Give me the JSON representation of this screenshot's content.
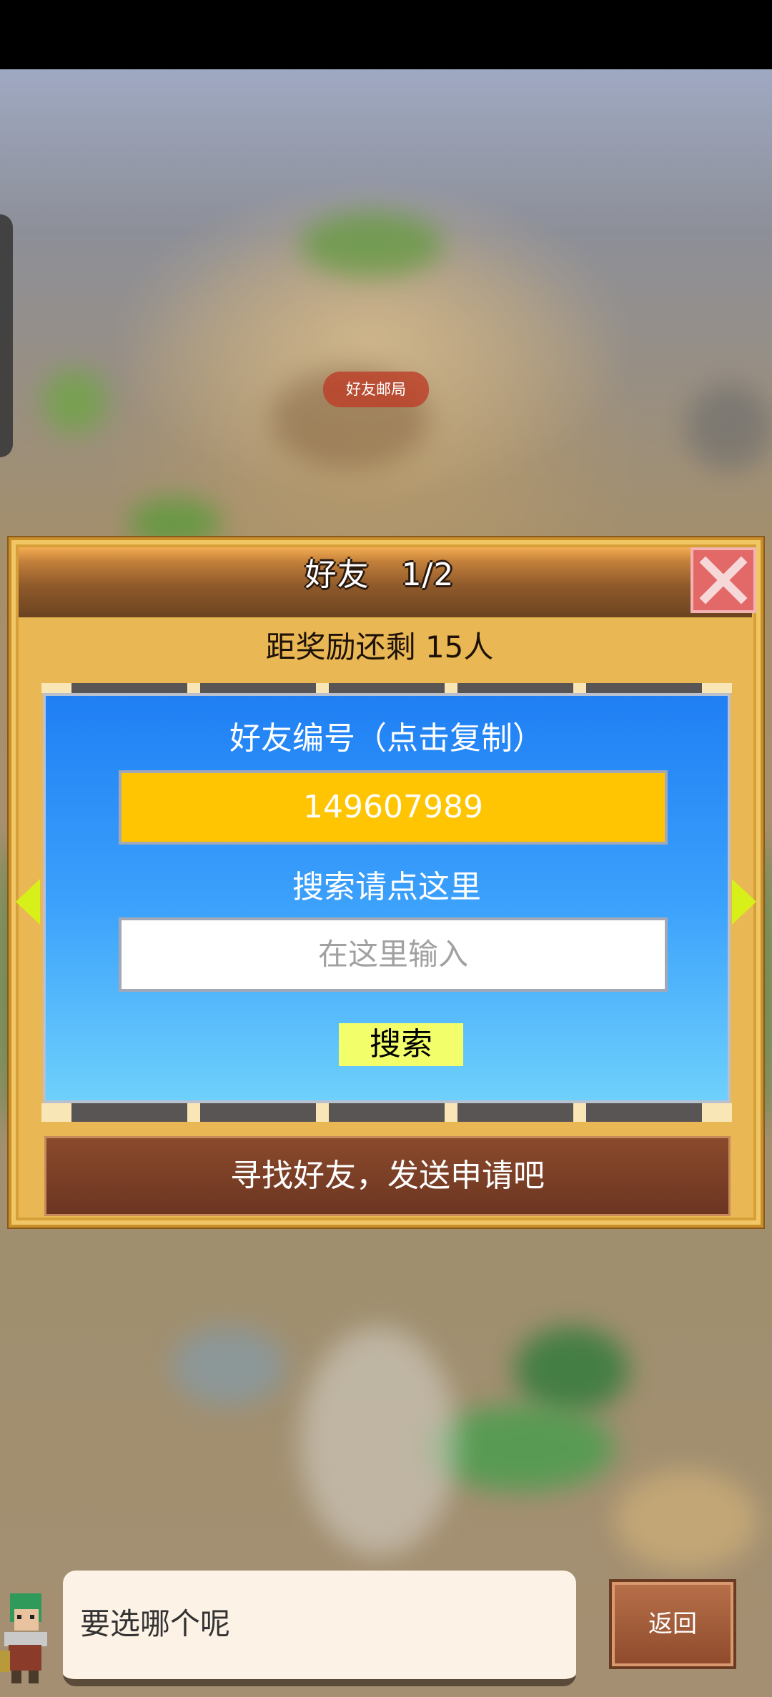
{
  "map": {
    "building_label": "好友邮局"
  },
  "dialog": {
    "title": "好友   1/2",
    "reward_text": "距奖励还剩 15人",
    "friend_code_label": "好友编号（点击复制）",
    "friend_code": "149607989",
    "search_hint": "搜索请点这里",
    "search_placeholder": "在这里输入",
    "search_button": "搜索",
    "find_friends_button": "寻找好友，发送申请吧"
  },
  "footer": {
    "speech_text": "要选哪个呢",
    "back_button": "返回"
  },
  "colors": {
    "dialog_bg": "#e9b753",
    "panel_blue": "#1f7ff4",
    "code_box": "#ffc503",
    "search_button": "#f3ff6a",
    "close_button": "#e36868",
    "arrow": "#d8f01a"
  },
  "icons": [
    "close-icon",
    "arrow-left-icon",
    "arrow-right-icon",
    "character-avatar"
  ]
}
